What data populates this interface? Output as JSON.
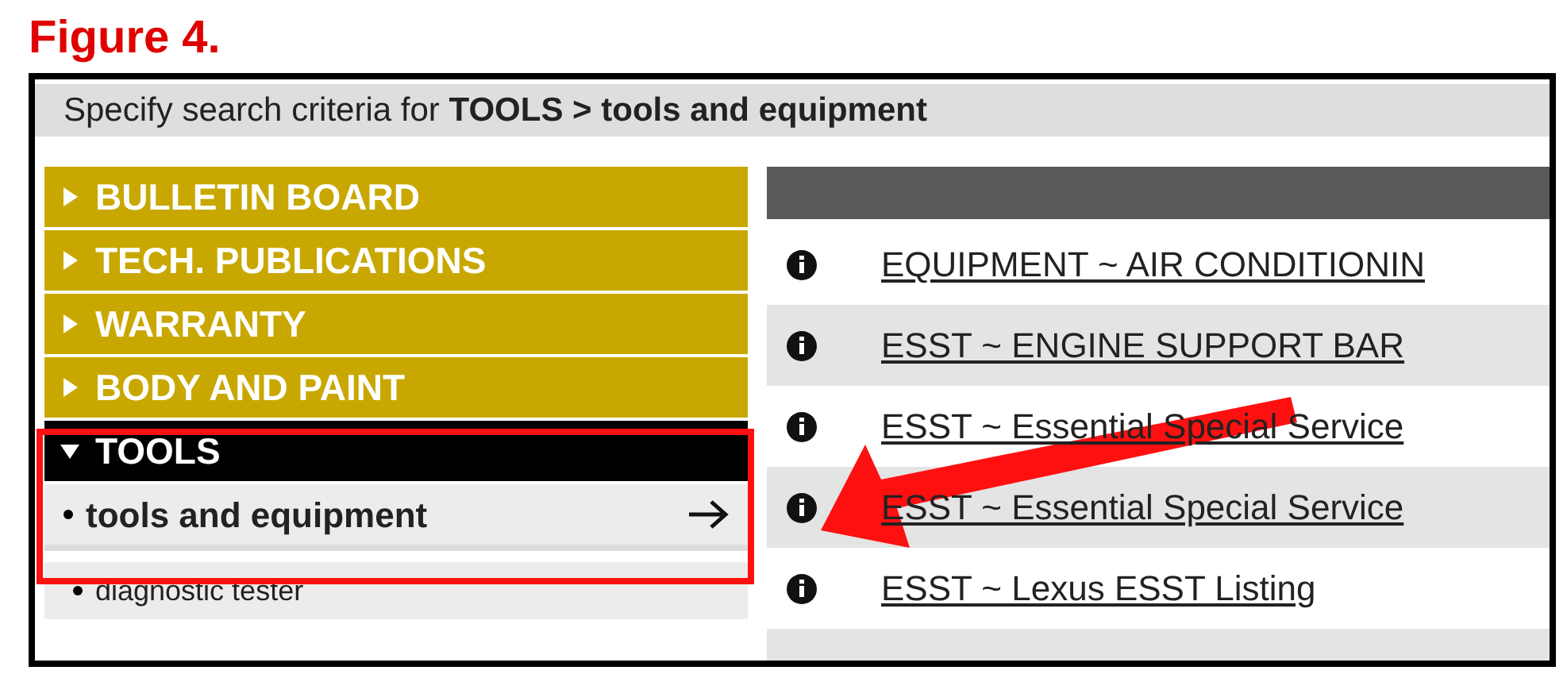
{
  "caption": "Figure 4.",
  "header": {
    "text": "Specify search criteria for **TOOLS > tools and equipment**"
  },
  "menu": [
    {
      "label": "BULLETIN BOARD",
      "expanded": false
    },
    {
      "label": "TECH. PUBLICATIONS",
      "expanded": false
    },
    {
      "label": "WARRANTY",
      "expanded": false
    },
    {
      "label": "BODY AND PAINT",
      "expanded": false
    },
    {
      "label": "TOOLS",
      "expanded": true,
      "children": [
        {
          "label": "tools and equipment",
          "selected": true
        },
        {
          "label": "diagnostic tester",
          "selected": false
        }
      ]
    }
  ],
  "results": [
    {
      "text": "EQUIPMENT ~ AIR CONDITIONIN"
    },
    {
      "text": "ESST ~ ENGINE SUPPORT BAR"
    },
    {
      "text": "ESST ~ Essential Special Service"
    },
    {
      "text": "ESST ~ Essential Special Service"
    },
    {
      "text": "ESST ~ Lexus ESST Listing"
    }
  ]
}
